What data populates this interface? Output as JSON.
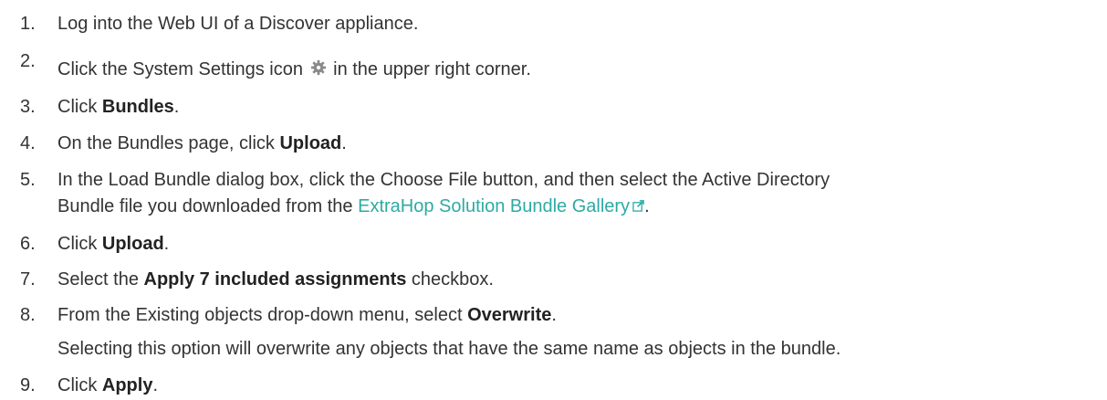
{
  "steps": [
    {
      "num": "1.",
      "text": "Log into the Web UI of a Discover appliance."
    },
    {
      "num": "2.",
      "before": "Click the System Settings icon",
      "after": " in the upper right corner.",
      "icon": "gear-icon"
    },
    {
      "num": "3.",
      "before": "Click ",
      "bold": "Bundles",
      "after": "."
    },
    {
      "num": "4.",
      "before": "On the Bundles page, click ",
      "bold": "Upload",
      "after": "."
    },
    {
      "num": "5.",
      "line1": "In the Load Bundle dialog box, click the Choose File button, and then select the Active Directory",
      "line2_before": "Bundle file you downloaded from the ",
      "link": "ExtraHop Solution Bundle Gallery",
      "line2_after": ".",
      "link_icon": "external-link-icon"
    },
    {
      "num": "6.",
      "before": "Click ",
      "bold": "Upload",
      "after": "."
    },
    {
      "num": "7.",
      "before": "Select the ",
      "bold": "Apply 7 included assignments",
      "after": " checkbox."
    },
    {
      "num": "8.",
      "before": "From the Existing objects drop-down menu, select ",
      "bold": "Overwrite",
      "after": ".",
      "note": "Selecting this option will overwrite any objects that have the same name as objects in the bundle."
    },
    {
      "num": "9.",
      "before": "Click ",
      "bold": "Apply",
      "after": "."
    }
  ],
  "colors": {
    "text": "#333333",
    "link": "#2eaaa4",
    "icon": "#8a8a8a"
  }
}
